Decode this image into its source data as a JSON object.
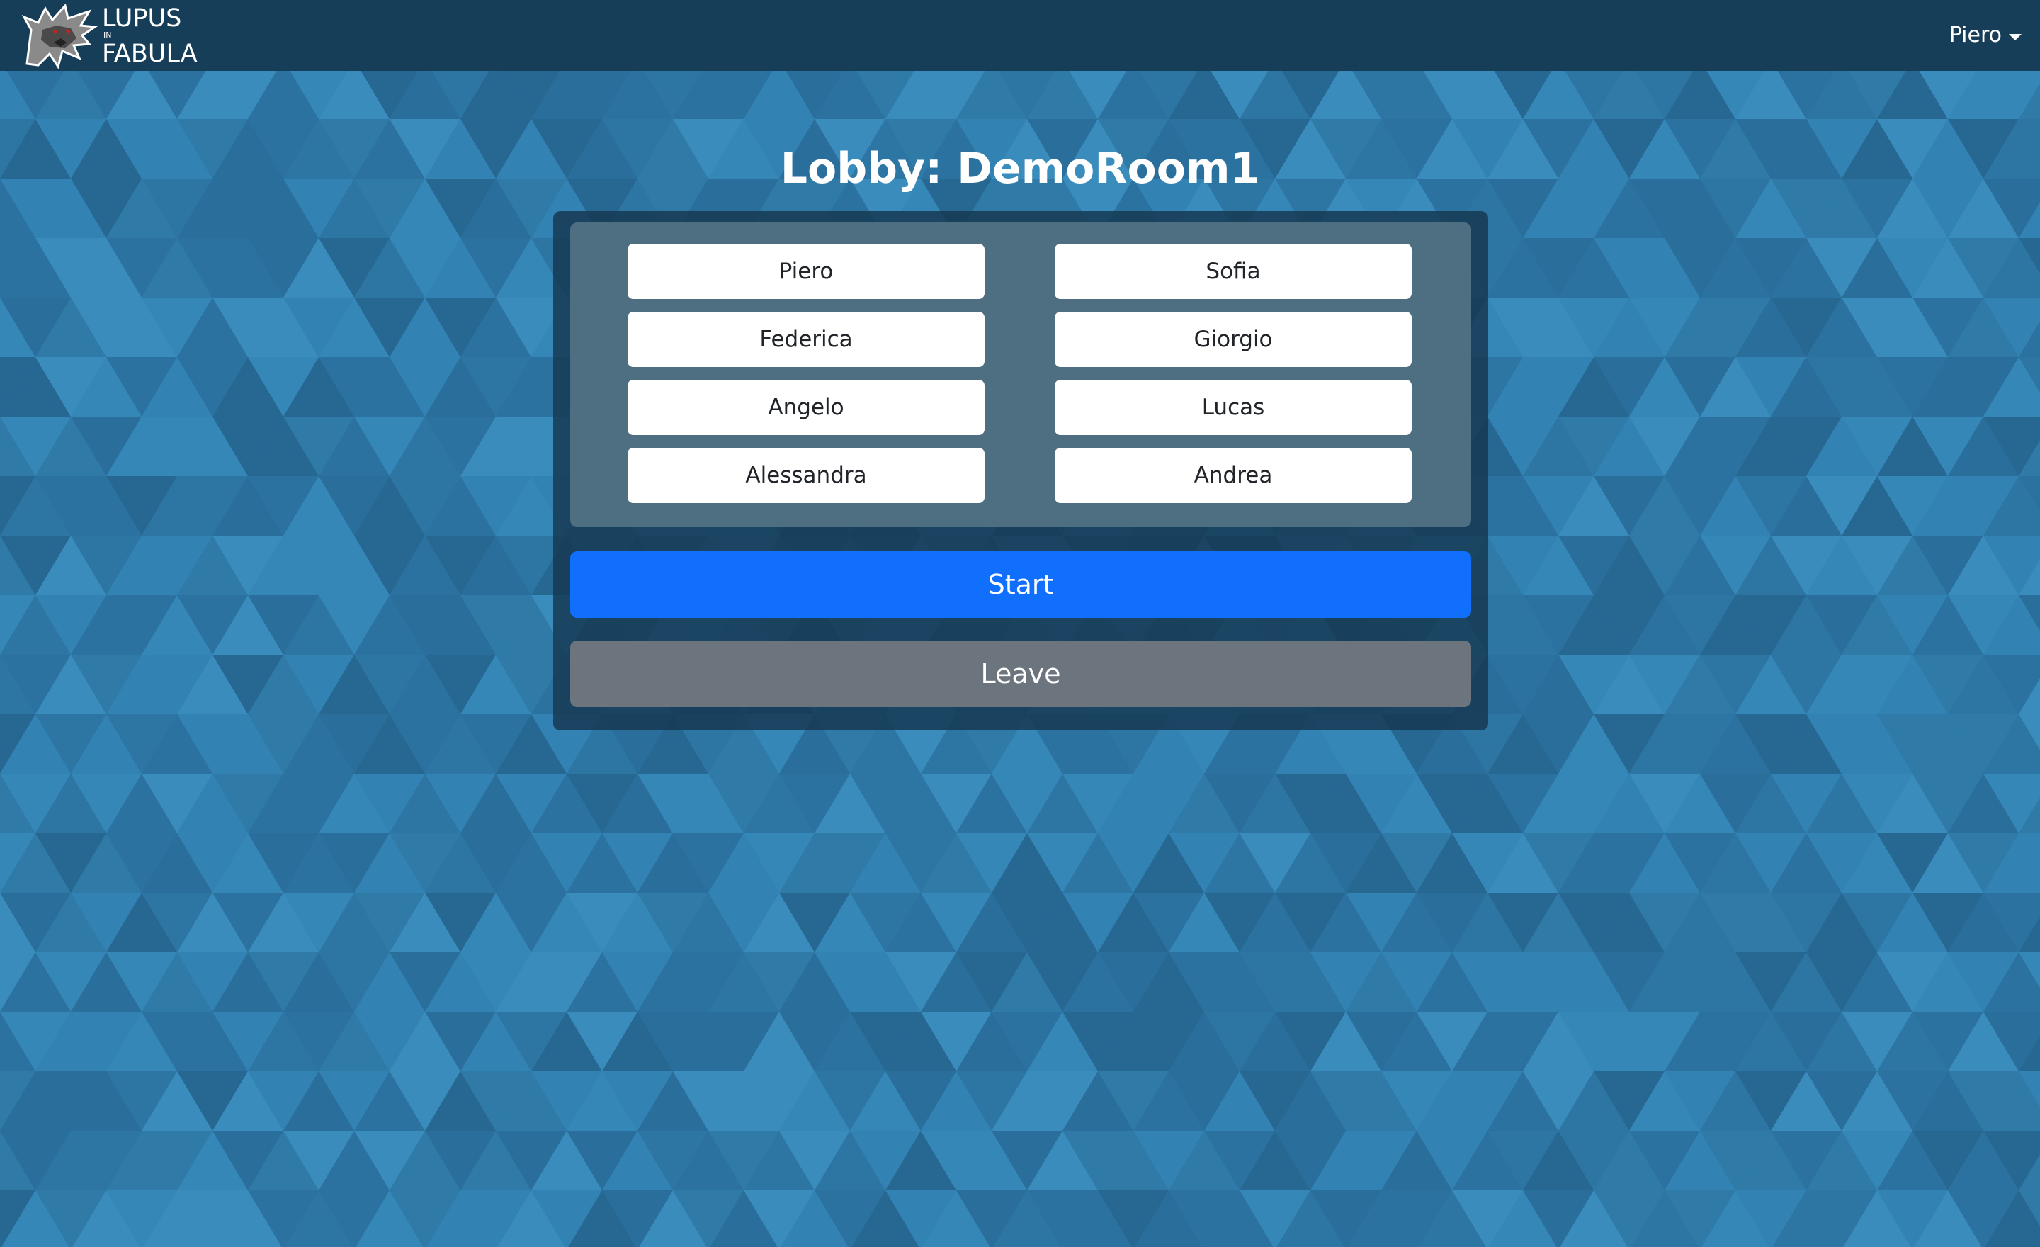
{
  "navbar": {
    "brand": {
      "line1": "LUPUS",
      "line2": "IN",
      "line3": "FABULA",
      "logo_icon": "wolf-head-icon"
    },
    "user": {
      "name": "Piero",
      "menu_icon": "caret-down-icon"
    }
  },
  "lobby": {
    "title": "Lobby: DemoRoom1",
    "players": [
      "Piero",
      "Sofia",
      "Federica",
      "Giorgio",
      "Angelo",
      "Lucas",
      "Alessandra",
      "Andrea"
    ],
    "start_label": "Start",
    "leave_label": "Leave"
  },
  "colors": {
    "navbar": "#163e58",
    "background": "#2f7aa7",
    "start": "#116ffe",
    "leave": "#6c757d"
  }
}
